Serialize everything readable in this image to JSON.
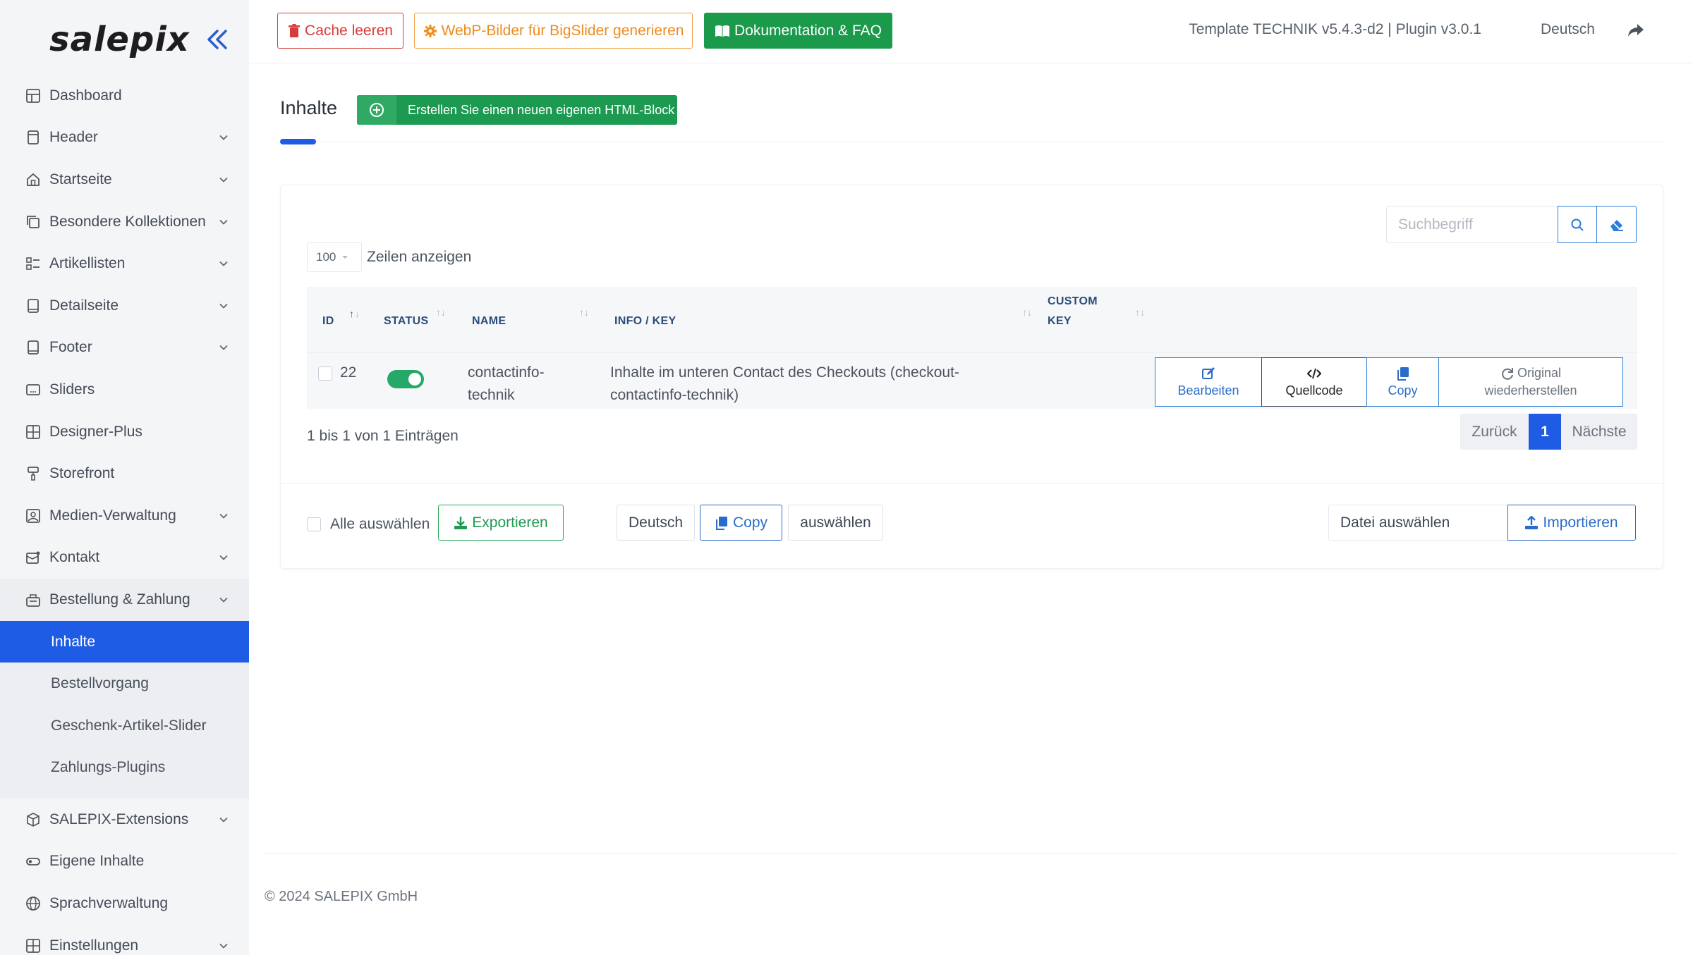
{
  "brand": "salepix",
  "sidebar": {
    "items": [
      {
        "label": "Dashboard",
        "icon": "layout-icon",
        "has_children": false
      },
      {
        "label": "Header",
        "icon": "browser-window-icon",
        "has_children": true
      },
      {
        "label": "Startseite",
        "icon": "home-icon",
        "has_children": true
      },
      {
        "label": "Besondere Kollektionen",
        "icon": "collection-icon",
        "has_children": true
      },
      {
        "label": "Artikellisten",
        "icon": "list-icon",
        "has_children": true
      },
      {
        "label": "Detailseite",
        "icon": "tablet-icon",
        "has_children": true
      },
      {
        "label": "Footer",
        "icon": "tablet-icon",
        "has_children": true
      },
      {
        "label": "Sliders",
        "icon": "slider-icon",
        "has_children": false
      },
      {
        "label": "Designer-Plus",
        "icon": "grid-icon",
        "has_children": false
      },
      {
        "label": "Storefront",
        "icon": "paint-roller-icon",
        "has_children": false
      },
      {
        "label": "Medien-Verwaltung",
        "icon": "image-icon",
        "has_children": true
      },
      {
        "label": "Kontakt",
        "icon": "mail-icon",
        "has_children": true
      },
      {
        "label": "Bestellung & Zahlung",
        "icon": "basket-icon",
        "has_children": true
      }
    ],
    "sub_items": [
      {
        "label": "Inhalte",
        "active": true
      },
      {
        "label": "Bestellvorgang",
        "active": false
      },
      {
        "label": "Geschenk-Artikel-Slider",
        "active": false
      },
      {
        "label": "Zahlungs-Plugins",
        "active": false
      }
    ],
    "items_after": [
      {
        "label": "SALEPIX-Extensions",
        "icon": "box-icon",
        "has_children": true
      },
      {
        "label": "Eigene Inhalte",
        "icon": "toggle-icon",
        "has_children": false
      },
      {
        "label": "Sprachverwaltung",
        "icon": "globe-icon",
        "has_children": false
      },
      {
        "label": "Einstellungen",
        "icon": "grid-icon",
        "has_children": true
      }
    ]
  },
  "topbar": {
    "cache_label": "Cache leeren",
    "webp_label": "WebP-Bilder für BigSlider generieren",
    "doc_label": "Dokumentation & FAQ",
    "template_info": "Template TECHNIK v5.4.3-d2 | Plugin v3.0.1",
    "language": "Deutsch"
  },
  "page": {
    "title": "Inhalte",
    "create_label": "Erstellen Sie einen neuen eigenen HTML-Block"
  },
  "table": {
    "search_placeholder": "Suchbegriff",
    "page_length": "100",
    "page_length_label": "Zeilen anzeigen",
    "headers": {
      "id": "ID",
      "status": "STATUS",
      "name": "NAME",
      "info": "INFO / KEY",
      "custom_key_1": "CUSTOM",
      "custom_key_2": "KEY"
    },
    "rows": [
      {
        "id": "22",
        "status_on": true,
        "name_line1": "contactinfo-",
        "name_line2": "technik",
        "info_line1": "Inhalte im unteren Contact des Checkouts (checkout-",
        "info_line2": "contactinfo-technik)",
        "custom_key": ""
      }
    ],
    "actions": {
      "edit": "Bearbeiten",
      "source": "Quellcode",
      "copy": "Copy",
      "restore_line1": "Original",
      "restore_line2": "wiederherstellen"
    },
    "info_count": "1 bis 1 von 1 Einträgen",
    "pager": {
      "prev": "Zurück",
      "current": "1",
      "next": "Nächste"
    }
  },
  "bulk": {
    "select_all": "Alle auswählen",
    "export": "Exportieren",
    "lang_button": "Deutsch",
    "copy": "Copy",
    "choose": "auswählen",
    "file_label": "Datei auswählen",
    "import": "Importieren"
  },
  "footer": {
    "copyright": "© 2024 SALEPIX GmbH"
  },
  "colors": {
    "accent": "#1f5ce6",
    "success": "#1d9a52",
    "danger": "#d93a3a",
    "warning": "#f08b1c",
    "info": "#2b7fd6"
  }
}
